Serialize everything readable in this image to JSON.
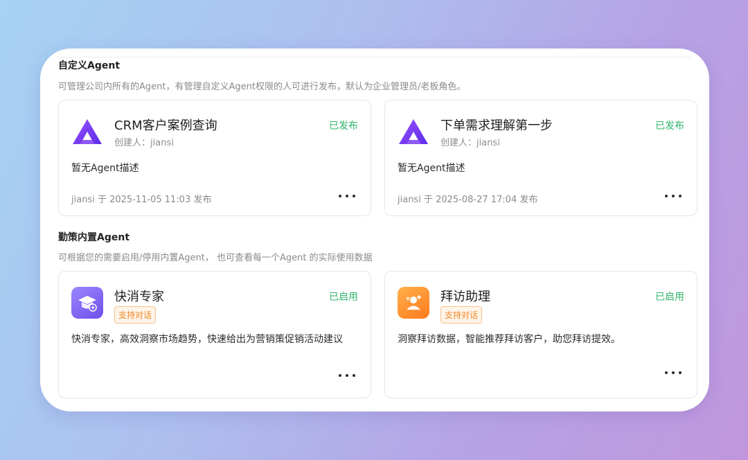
{
  "sections": {
    "custom": {
      "title": "自定义Agent",
      "description": "可管理公司内所有的Agent，有管理自定义Agent权限的人可进行发布，默认为企业管理员/老板角色。",
      "cards": [
        {
          "title": "CRM客户案例查询",
          "creator": "创建人：jiansi",
          "status": "已发布",
          "description": "暂无Agent描述",
          "meta": "jiansi 于 2025-11-05 11:03 发布",
          "icon": "agent-logo-icon"
        },
        {
          "title": "下单需求理解第一步",
          "creator": "创建人：jiansi",
          "status": "已发布",
          "description": "暂无Agent描述",
          "meta": "jiansi 于 2025-08-27 17:04 发布",
          "icon": "agent-logo-icon"
        }
      ]
    },
    "builtin": {
      "title": "勤策内置Agent",
      "description": "可根据您的需要启用/停用内置Agent， 也可查看每一个Agent 的实际使用数据",
      "cards": [
        {
          "title": "快消专家",
          "badge": "支持对话",
          "status": "已启用",
          "description": "快消专家，高效洞察市场趋势，快速给出为营销策促销活动建议",
          "icon": "graduation-cap-icon"
        },
        {
          "title": "拜访助理",
          "badge": "支持对话",
          "status": "已启用",
          "description": "洞察拜访数据，智能推荐拜访客户，助您拜访提效。",
          "icon": "visit-person-icon"
        }
      ]
    }
  },
  "colors": {
    "status_green": "#2fb56a",
    "badge_orange": "#f08a2a",
    "logo_purple": "#6f3cf0",
    "tile_orange": "#ff7a1e"
  }
}
